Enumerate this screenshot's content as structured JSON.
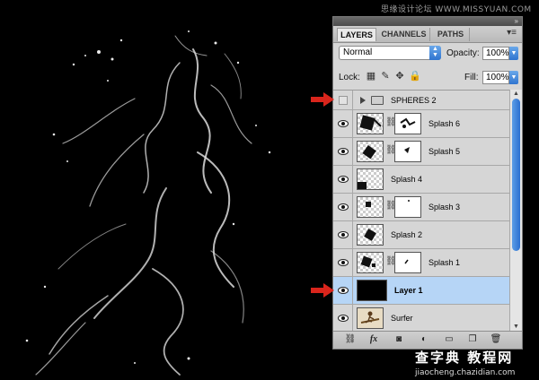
{
  "watermark": {
    "top": "思缘设计论坛 WWW.MISSYUAN.COM",
    "bottom_big": "查字典 教程网",
    "bottom_small": "jiaocheng.chazidian.com"
  },
  "panel": {
    "tabs": [
      {
        "label": "LAYERS",
        "active": true
      },
      {
        "label": "CHANNELS",
        "active": false
      },
      {
        "label": "PATHS",
        "active": false
      }
    ],
    "blend_mode": "Normal",
    "opacity_label": "Opacity:",
    "opacity_value": "100%",
    "lock_label": "Lock:",
    "fill_label": "Fill:",
    "fill_value": "100%",
    "layers": [
      {
        "name": "SPHERES 2",
        "type": "group",
        "visible": false,
        "thumb": "",
        "mask": false
      },
      {
        "name": "Splash 6",
        "type": "layer",
        "visible": true,
        "thumb": "transparent",
        "mask": true
      },
      {
        "name": "Splash 5",
        "type": "layer",
        "visible": true,
        "thumb": "transparent",
        "mask": true
      },
      {
        "name": "Splash 4",
        "type": "layer",
        "visible": true,
        "thumb": "transparent",
        "mask": false
      },
      {
        "name": "Splash 3",
        "type": "layer",
        "visible": true,
        "thumb": "transparent",
        "mask": true
      },
      {
        "name": "Splash 2",
        "type": "layer",
        "visible": true,
        "thumb": "transparent",
        "mask": false
      },
      {
        "name": "Splash 1",
        "type": "layer",
        "visible": true,
        "thumb": "transparent",
        "mask": true
      },
      {
        "name": "Layer 1",
        "type": "layer",
        "visible": true,
        "thumb": "black",
        "mask": false,
        "selected": true
      },
      {
        "name": "Surfer",
        "type": "layer",
        "visible": true,
        "thumb": "surfer",
        "mask": false
      }
    ],
    "bottom_icons": [
      "link-icon",
      "fx-icon",
      "mask-icon",
      "adjustment-icon",
      "folder-icon",
      "new-layer-icon",
      "trash-icon"
    ]
  },
  "colors": {
    "canvas_bg": "#000000",
    "panel_bg": "#d6d6d6",
    "selected_row": "#b6d5f6",
    "accent_blue": "#2f74cf",
    "arrow_red": "#d9251c"
  }
}
